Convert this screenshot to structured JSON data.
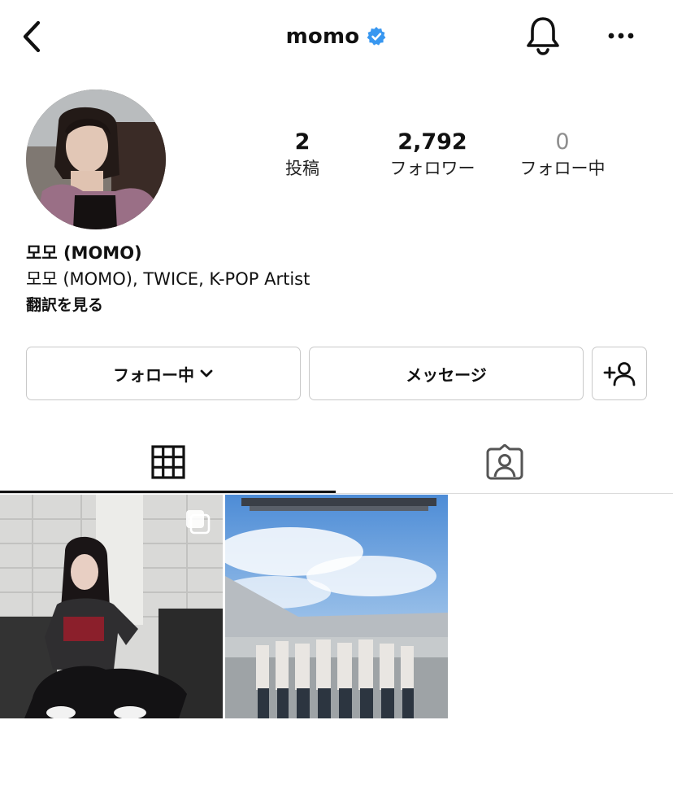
{
  "header": {
    "username": "momo",
    "verified": true,
    "icons": [
      "back-chevron-icon",
      "verified-badge-icon",
      "bell-icon",
      "more-dots-icon"
    ]
  },
  "stats": {
    "posts": {
      "value": "2",
      "label": "投稿"
    },
    "followers": {
      "value": "2,792",
      "label": "フォロワー"
    },
    "following": {
      "value": "0",
      "label": "フォロー中"
    }
  },
  "bio": {
    "name": "모모 (MOMO)",
    "text": "모모 (MOMO), TWICE, K-POP Artist",
    "translate": "翻訳を見る"
  },
  "actions": {
    "follow_label": "フォロー中",
    "message_label": "メッセージ"
  },
  "tabs": [
    {
      "name": "grid",
      "icon": "grid-icon",
      "active": true
    },
    {
      "name": "tagged",
      "icon": "tagged-person-icon",
      "active": false
    }
  ],
  "posts": [
    {
      "description_icon": "multi-photo-icon",
      "multiple": true
    },
    {
      "multiple": false
    }
  ],
  "colors": {
    "verified": "#3897f0",
    "border": "#dbdbdb",
    "muted": "#8e8e8e",
    "text": "#111111"
  }
}
